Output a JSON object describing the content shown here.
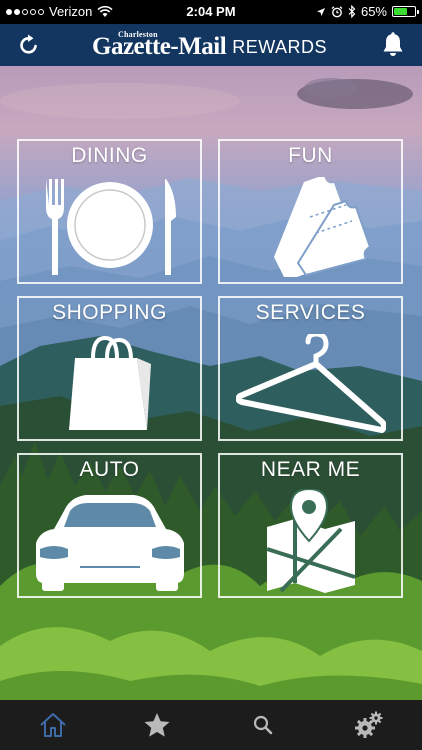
{
  "status_bar": {
    "carrier": "Verizon",
    "time": "2:04 PM",
    "battery": "65%",
    "battery_level": 0.65,
    "signal_bars": 2
  },
  "nav": {
    "brand_small": "Charleston",
    "brand_main": "Gazette-Mail",
    "brand_rewards": "REWARDS",
    "refresh_icon": "refresh-icon",
    "bell_icon": "bell-icon"
  },
  "categories": [
    {
      "label": "DINING",
      "icon": "plate-fork-knife-icon"
    },
    {
      "label": "FUN",
      "icon": "tickets-icon"
    },
    {
      "label": "SHOPPING",
      "icon": "shopping-bag-icon"
    },
    {
      "label": "SERVICES",
      "icon": "hanger-icon"
    },
    {
      "label": "AUTO",
      "icon": "car-icon"
    },
    {
      "label": "NEAR ME",
      "icon": "map-pin-icon"
    }
  ],
  "tab_bar": {
    "tabs": [
      {
        "name": "home",
        "icon": "home-icon",
        "active": true
      },
      {
        "name": "favorites",
        "icon": "star-icon",
        "active": false
      },
      {
        "name": "search",
        "icon": "search-icon",
        "active": false
      },
      {
        "name": "settings",
        "icon": "gears-icon",
        "active": false
      }
    ],
    "active_color": "#3f6aa8",
    "inactive_color": "#b9b9b9"
  },
  "colors": {
    "nav_background": "#123660",
    "battery_fill": "#3ddc32",
    "tab_background": "#1c1c1c"
  }
}
